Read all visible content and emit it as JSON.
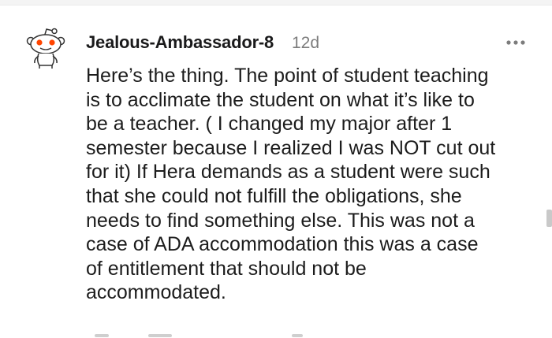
{
  "comment": {
    "author": "Jealous-Ambassador-8",
    "age": "12d",
    "more_icon": "more-options-icon",
    "avatar_icon": "reddit-snoo-avatar-icon",
    "body_lines": [
      "Here’s the thing. The point of student teaching",
      "is to acclimate the student on what it’s like to",
      "be a teacher. ( I changed my major after 1",
      "semester because I realized I was NOT cut out",
      "for it) If Hera demands as a student were such",
      "that she could not fulfill the obligations, she",
      "needs to find something else. This was not a",
      "case of ADA accommodation this was a case",
      "of entitlement that should not be",
      "accommodated."
    ]
  },
  "colors": {
    "author": "#1a1a1b",
    "timestamp": "#7c7c7c",
    "body": "#1c1c1c",
    "avatar_accent": "#ff4500"
  }
}
